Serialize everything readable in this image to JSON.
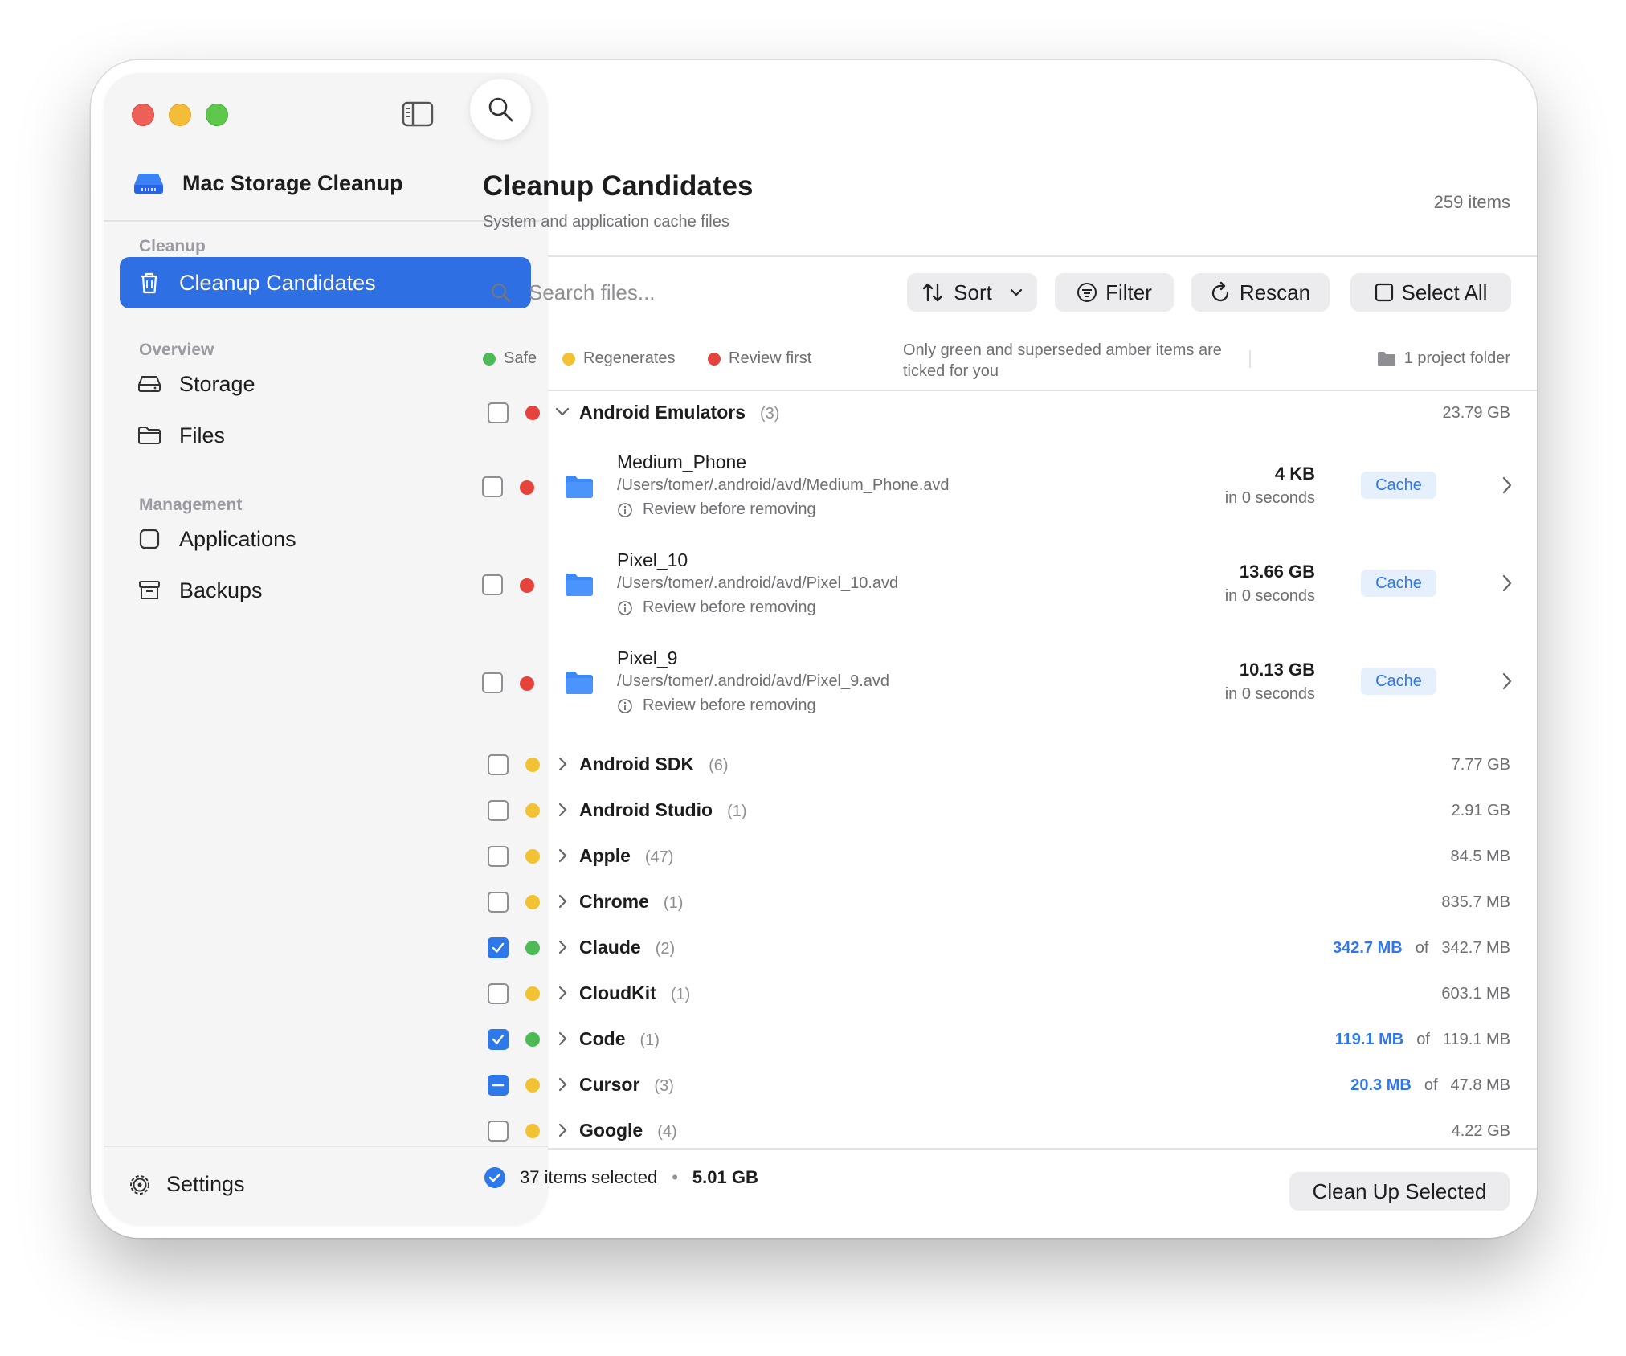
{
  "app": {
    "name": "Mac Storage Cleanup"
  },
  "sidebar": {
    "sections": {
      "cleanup": "Cleanup",
      "overview": "Overview",
      "management": "Management"
    },
    "items": [
      {
        "label": "Cleanup Candidates",
        "icon": "trash-icon",
        "active": true
      },
      {
        "label": "Storage",
        "icon": "drive-icon"
      },
      {
        "label": "Files",
        "icon": "folder-icon"
      },
      {
        "label": "Applications",
        "icon": "app-square-icon"
      },
      {
        "label": "Backups",
        "icon": "archive-box-icon"
      }
    ],
    "settings": "Settings"
  },
  "header": {
    "title": "Cleanup Candidates",
    "subtitle": "System and application cache files",
    "count": "259 items"
  },
  "toolbar": {
    "search_placeholder": "Search files...",
    "sort": "Sort",
    "filter": "Filter",
    "rescan": "Rescan",
    "select_all": "Select All"
  },
  "legend": {
    "safe": "Safe",
    "regenerates": "Regenerates",
    "review": "Review first",
    "note": "Only green and superseded amber items are ticked for you",
    "project_folder": "1 project folder"
  },
  "colors": {
    "accent": "#2f78ea",
    "safe": "#4cba55",
    "regenerates": "#f3c233",
    "review": "#e5433c"
  },
  "groups": [
    {
      "name": "Android Emulators",
      "count": "(3)",
      "size": "23.79 GB",
      "status": "review",
      "expanded": true,
      "check": "none"
    },
    {
      "name": "Android SDK",
      "count": "(6)",
      "size": "7.77 GB",
      "status": "regenerates",
      "check": "none"
    },
    {
      "name": "Android Studio",
      "count": "(1)",
      "size": "2.91 GB",
      "status": "regenerates",
      "check": "none"
    },
    {
      "name": "Apple",
      "count": "(47)",
      "size": "84.5 MB",
      "status": "regenerates",
      "check": "none"
    },
    {
      "name": "Chrome",
      "count": "(1)",
      "size": "835.7 MB",
      "status": "regenerates",
      "check": "none"
    },
    {
      "name": "Claude",
      "count": "(2)",
      "selected": "342.7 MB",
      "of": "of",
      "size": "342.7 MB",
      "status": "safe",
      "check": "checked"
    },
    {
      "name": "CloudKit",
      "count": "(1)",
      "size": "603.1 MB",
      "status": "regenerates",
      "check": "none"
    },
    {
      "name": "Code",
      "count": "(1)",
      "selected": "119.1 MB",
      "of": "of",
      "size": "119.1 MB",
      "status": "safe",
      "check": "checked"
    },
    {
      "name": "Cursor",
      "count": "(3)",
      "selected": "20.3 MB",
      "of": "of",
      "size": "47.8 MB",
      "status": "regenerates",
      "check": "mixed"
    },
    {
      "name": "Google",
      "count": "(4)",
      "size": "4.22 GB",
      "status": "regenerates",
      "check": "none"
    }
  ],
  "children": [
    {
      "name": "Medium_Phone",
      "path": "/Users/tomer/.android/avd/Medium_Phone.avd",
      "note": "Review before removing",
      "size": "4 KB",
      "time": "in 0 seconds",
      "tag": "Cache"
    },
    {
      "name": "Pixel_10",
      "path": "/Users/tomer/.android/avd/Pixel_10.avd",
      "note": "Review before removing",
      "size": "13.66 GB",
      "time": "in 0 seconds",
      "tag": "Cache"
    },
    {
      "name": "Pixel_9",
      "path": "/Users/tomer/.android/avd/Pixel_9.avd",
      "note": "Review before removing",
      "size": "10.13 GB",
      "time": "in 0 seconds",
      "tag": "Cache"
    }
  ],
  "footer": {
    "selected_count": "37 items selected",
    "bullet": "•",
    "total": "5.01 GB",
    "cleanup_button": "Clean Up Selected"
  }
}
